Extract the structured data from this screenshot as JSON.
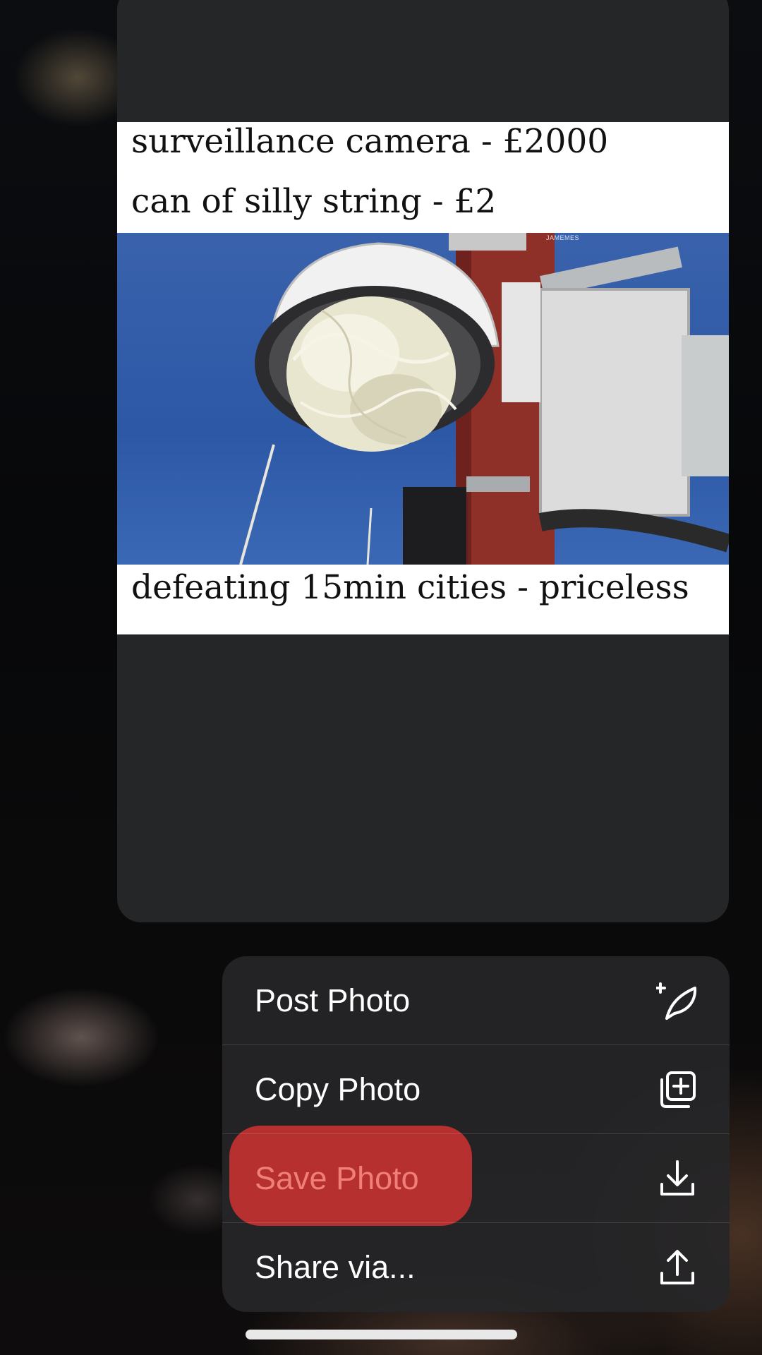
{
  "meme": {
    "caption_top": "surveillance camera - £2000",
    "caption_middle": "can of silly string - £2",
    "caption_bottom": "defeating 15min cities - priceless",
    "watermark": "JAMEMES"
  },
  "menu": {
    "items": [
      {
        "label": "Post Photo",
        "icon": "compose-feather-plus-icon"
      },
      {
        "label": "Copy Photo",
        "icon": "copy-plus-icon"
      },
      {
        "label": "Save Photo",
        "icon": "download-icon"
      },
      {
        "label": "Share via...",
        "icon": "share-upload-icon"
      }
    ],
    "highlight_color": "#b5302f",
    "highlight_text_color": "#f07f7a"
  },
  "colors": {
    "menu_background": "#262628",
    "card_background": "#252628"
  }
}
